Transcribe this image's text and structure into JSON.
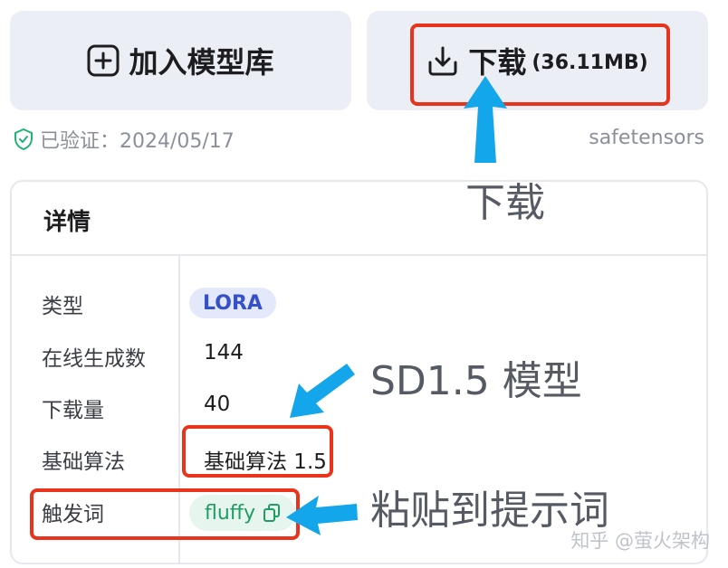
{
  "actions": {
    "add_label": "加入模型库",
    "download_label": "下载",
    "download_size": "(36.11MB)"
  },
  "meta": {
    "verified_text": "已验证：2024/05/17",
    "format": "safetensors"
  },
  "details": {
    "title": "详情",
    "rows": [
      {
        "label": "类型",
        "value": "LORA"
      },
      {
        "label": "在线生成数",
        "value": "144"
      },
      {
        "label": "下载量",
        "value": "40"
      },
      {
        "label": "基础算法",
        "value": "基础算法 1.5"
      },
      {
        "label": "触发词",
        "value": "fluffy"
      }
    ]
  },
  "annotations": {
    "download": "下载",
    "sd_model": "SD1.5 模型",
    "paste_prompt": "粘贴到提示词"
  },
  "watermark": "知乎 @萤火架构",
  "colors": {
    "button_bg": "#eceef5",
    "highlight_red": "#e8341c",
    "arrow_blue": "#14a6ea",
    "lora_text": "#3550c8",
    "trigger_text": "#1f9d62",
    "verified_green": "#1fb372"
  }
}
